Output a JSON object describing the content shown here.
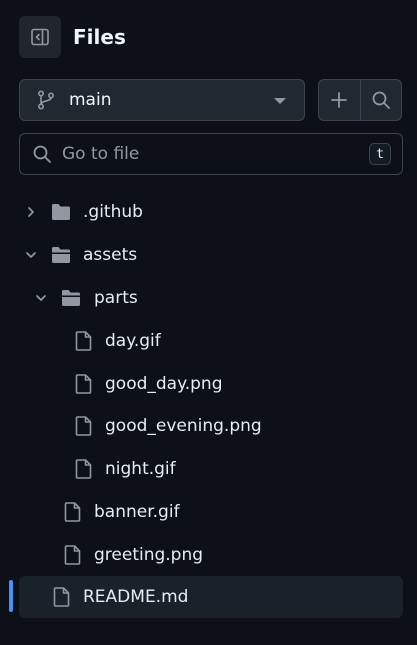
{
  "header": {
    "title": "Files",
    "panel_icon": "sidebar-collapse-icon"
  },
  "branch": {
    "name": "main",
    "icon": "git-branch-icon"
  },
  "actions": {
    "add_icon": "plus-icon",
    "search_icon": "search-icon"
  },
  "search": {
    "placeholder": "Go to file",
    "shortcut": "t"
  },
  "tree": [
    {
      "label": ".github",
      "type": "folder",
      "expanded": false
    },
    {
      "label": "assets",
      "type": "folder",
      "expanded": true
    },
    {
      "label": "parts",
      "type": "folder",
      "expanded": true
    },
    {
      "label": "day.gif",
      "type": "file"
    },
    {
      "label": "good_day.png",
      "type": "file"
    },
    {
      "label": "good_evening.png",
      "type": "file"
    },
    {
      "label": "night.gif",
      "type": "file"
    },
    {
      "label": "banner.gif",
      "type": "file"
    },
    {
      "label": "greeting.png",
      "type": "file"
    },
    {
      "label": "README.md",
      "type": "file",
      "selected": true
    }
  ],
  "colors": {
    "background": "#0d1117",
    "text": "#e6edf3",
    "muted": "#9198a1",
    "accent": "#4493f8",
    "border": "#3d444d"
  }
}
